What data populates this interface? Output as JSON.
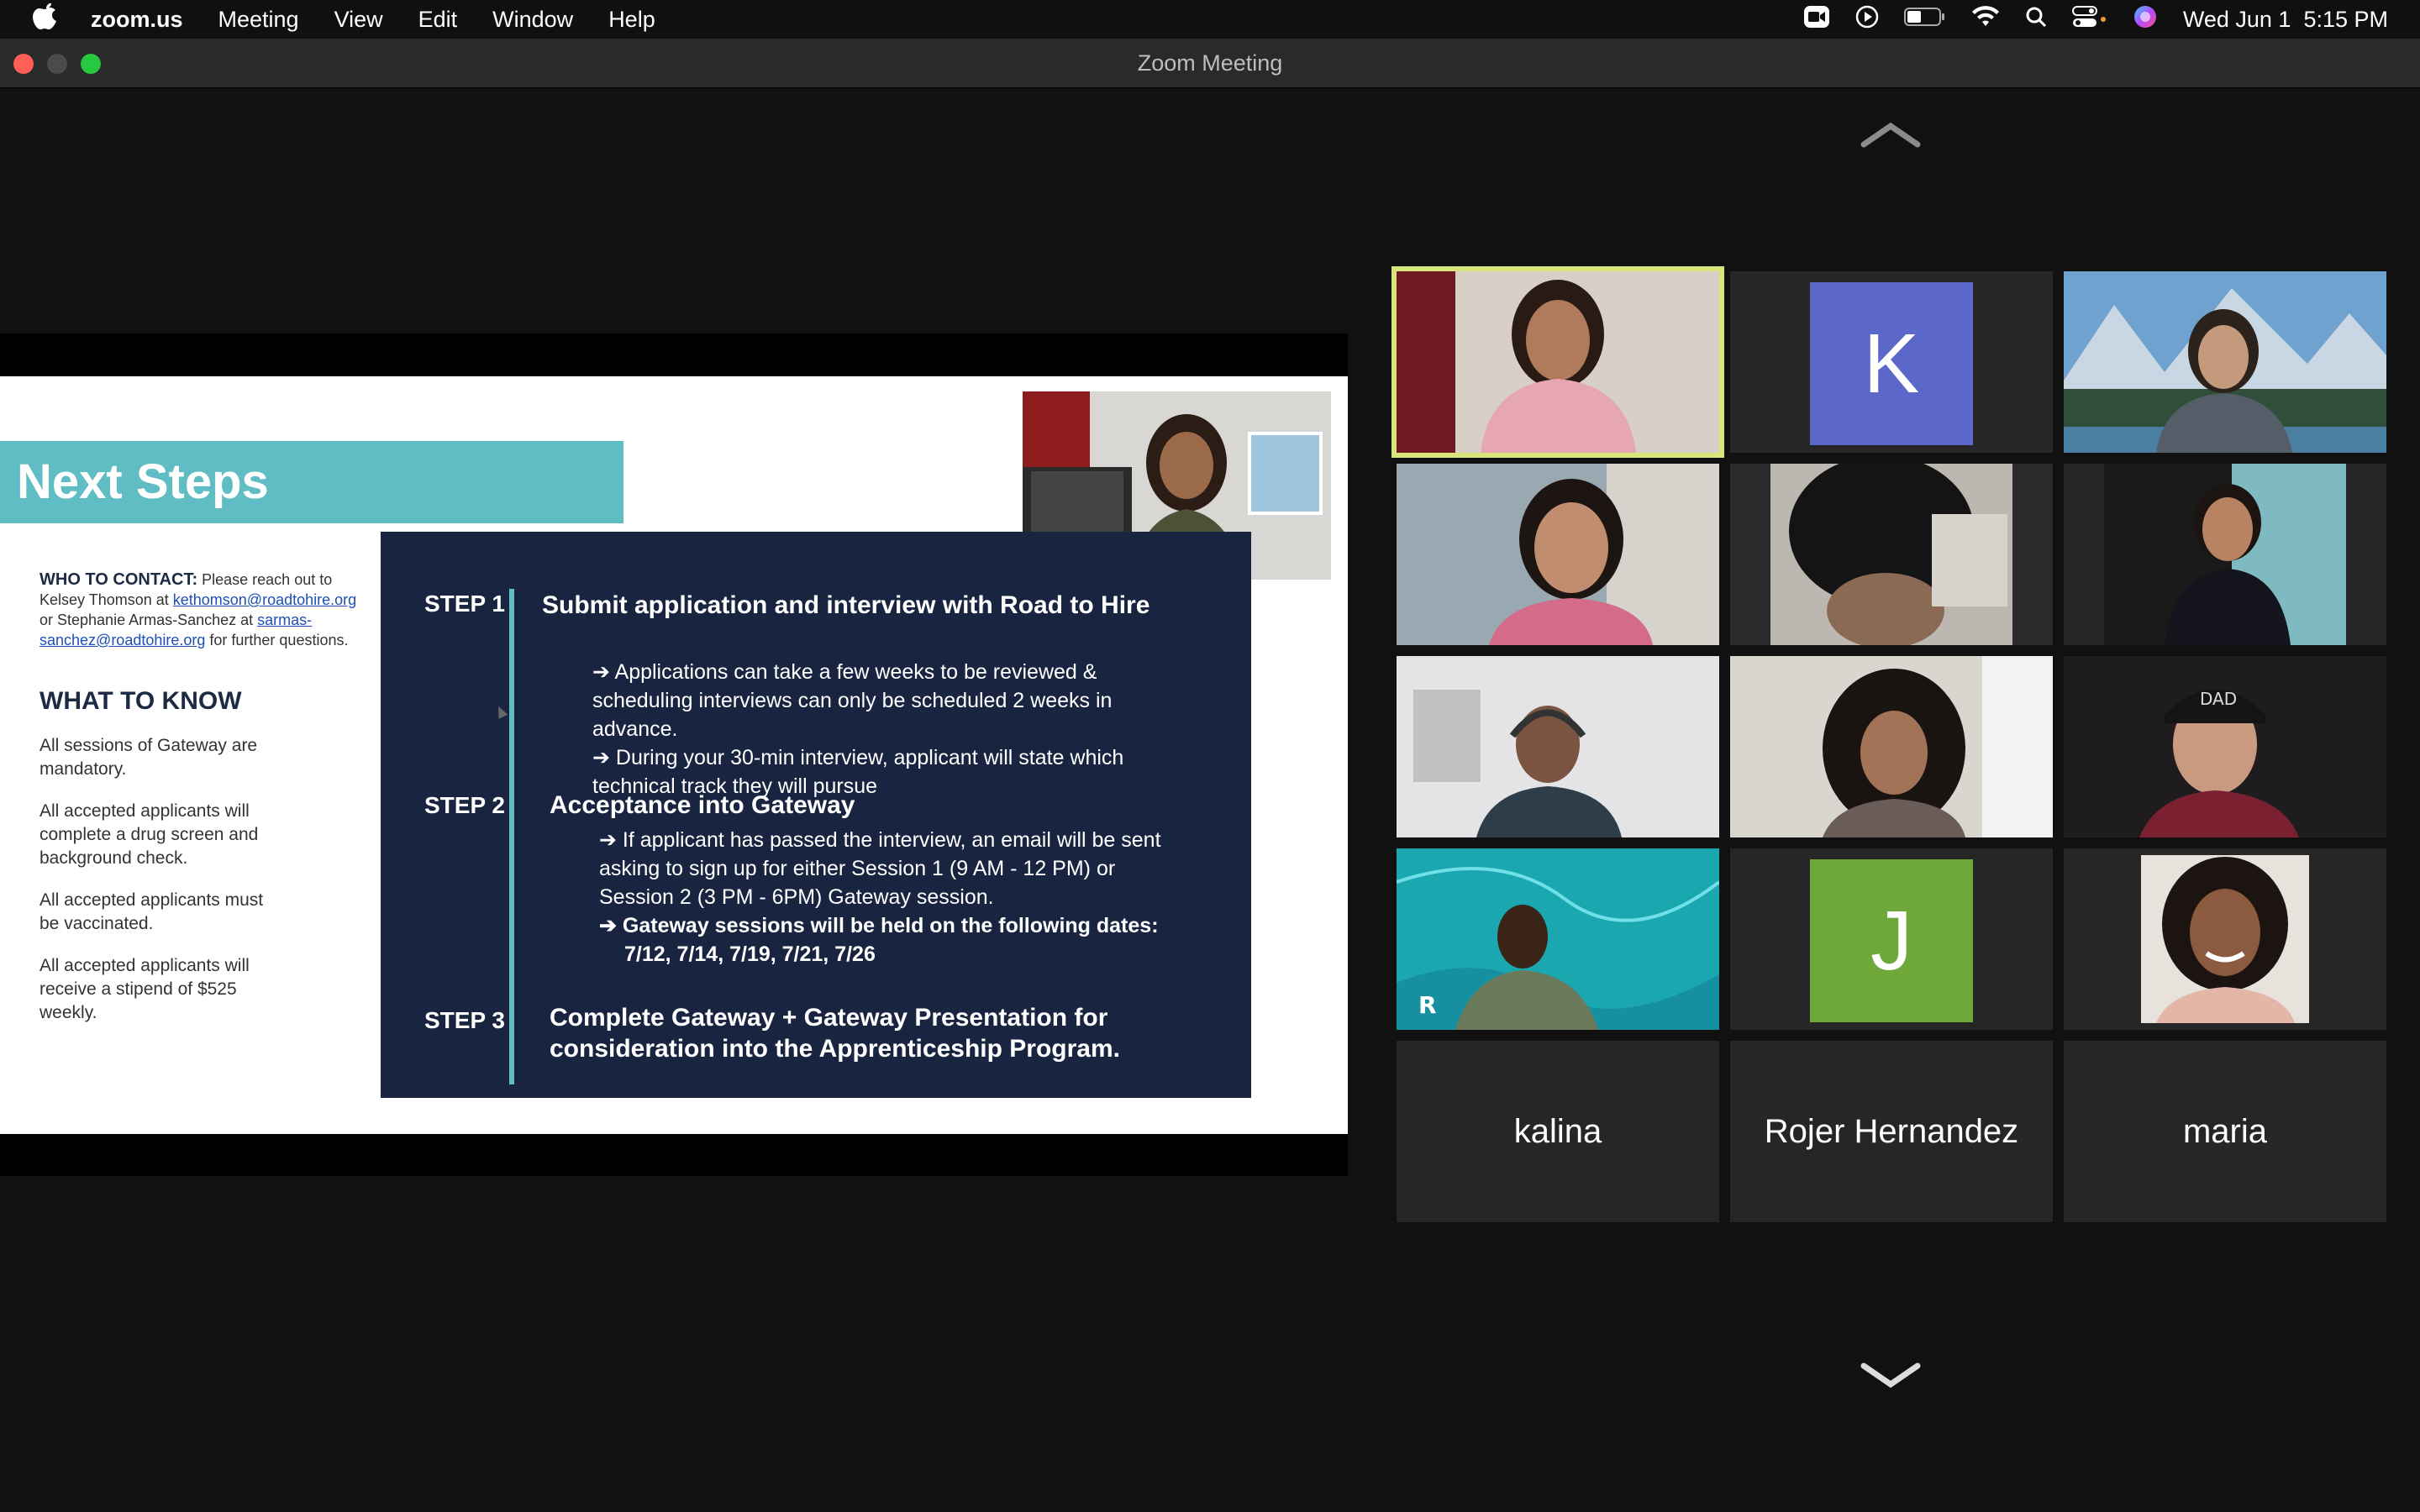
{
  "menubar": {
    "app_name": "zoom.us",
    "menus": [
      "Meeting",
      "View",
      "Edit",
      "Window",
      "Help"
    ],
    "clock": "Wed Jun 1  5:15 PM"
  },
  "window": {
    "title": "Zoom Meeting"
  },
  "slide": {
    "title": "Next Steps",
    "contact_label": "WHO TO CONTACT:",
    "contact_text_1": " Please reach out to Kelsey Thomson at ",
    "contact_email_1": "kethomson@roadtohire.org",
    "contact_text_2": " or Stephanie Armas-Sanchez at ",
    "contact_email_2": "sarmas-sanchez@roadtohire.org",
    "contact_text_3": " for further questions.",
    "know_title": "WHAT TO KNOW",
    "know_items": [
      "All sessions of Gateway are\nmandatory.",
      "All accepted applicants will\ncomplete a drug screen and\nbackground check.",
      "All accepted applicants must\nbe vaccinated.",
      "All accepted applicants will\nreceive a stipend of $525\nweekly."
    ],
    "steps": [
      {
        "label": "STEP 1",
        "heading": "Submit application and interview with Road to Hire",
        "bullets": [
          "➔ Applications can take a few weeks to be reviewed & scheduling interviews can only be scheduled 2 weeks in advance.",
          "➔ During your 30-min interview, applicant will state which technical track they will pursue"
        ]
      },
      {
        "label": "STEP 2",
        "heading": "Acceptance into Gateway",
        "bullets": [
          "➔ If applicant has passed the interview, an email will be sent asking to sign up for either Session 1 (9 AM - 12 PM) or Session 2 (3 PM - 6PM) Gateway session.",
          "➔ Gateway sessions will be held on the following dates:",
          "7/12, 7/14, 7/19, 7/21, 7/26"
        ]
      },
      {
        "label": "STEP 3",
        "heading": "Complete Gateway + Gateway Presentation for consideration into the Apprenticeship Program.",
        "bullets": []
      }
    ]
  },
  "participants": [
    {
      "type": "video",
      "active": true
    },
    {
      "type": "avatar",
      "initial": "K",
      "color": "#5b67c9"
    },
    {
      "type": "video"
    },
    {
      "type": "video"
    },
    {
      "type": "video"
    },
    {
      "type": "video"
    },
    {
      "type": "video"
    },
    {
      "type": "video"
    },
    {
      "type": "video"
    },
    {
      "type": "video"
    },
    {
      "type": "avatar",
      "initial": "J",
      "color": "#6ea73a"
    },
    {
      "type": "video"
    },
    {
      "type": "name",
      "name": "kalina"
    },
    {
      "type": "name",
      "name": "Rojer Hernandez"
    },
    {
      "type": "name",
      "name": "maria"
    }
  ],
  "colors": {
    "accent_teal": "#5fbdc3",
    "slide_navy": "#192540",
    "active_speaker": "#d9e57a"
  }
}
